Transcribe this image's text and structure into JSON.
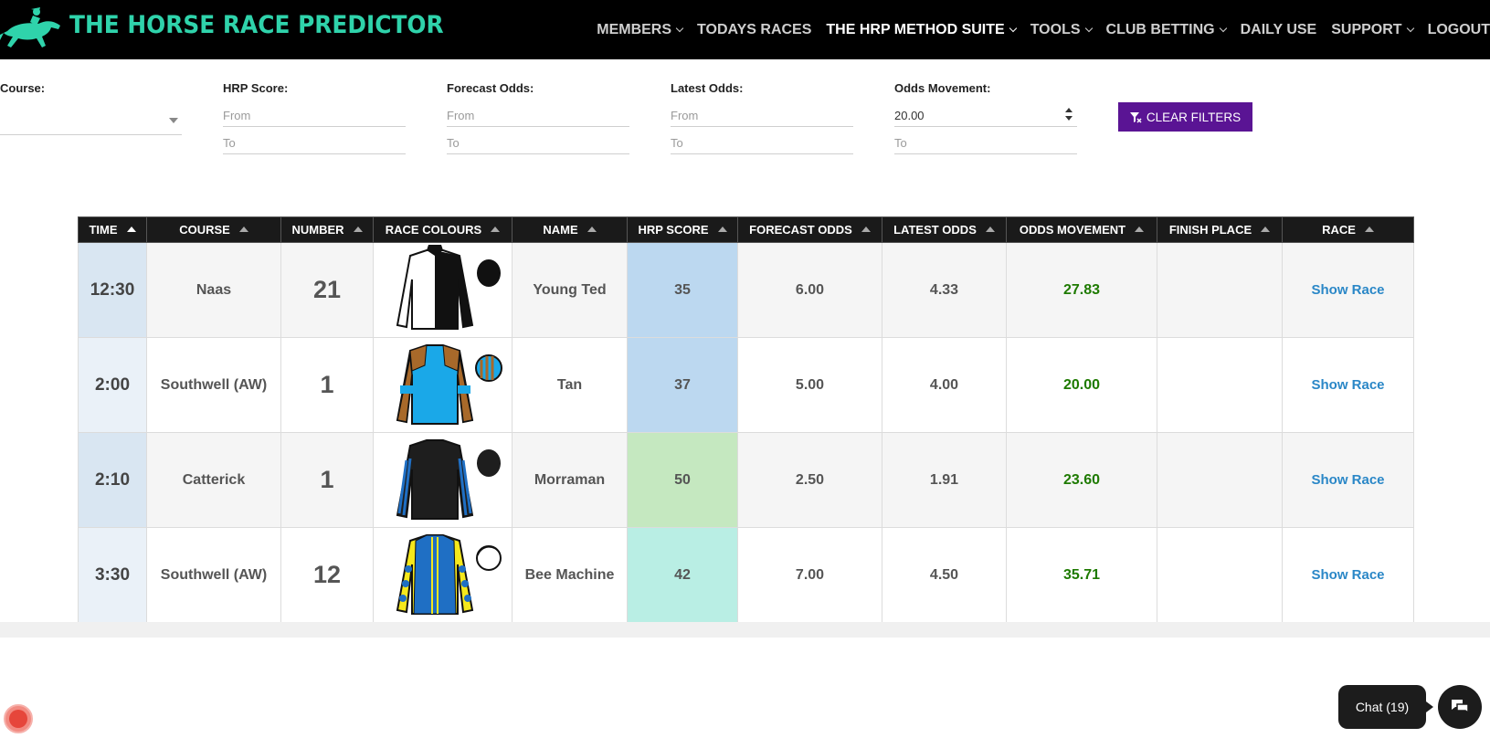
{
  "brand": {
    "name": "THE HORSE RACE PREDICTOR",
    "color": "#2fd3ab",
    "logo_icon": "horse-jockey-icon"
  },
  "nav": {
    "items": [
      {
        "label": "MEMBERS",
        "dropdown": true,
        "active": false
      },
      {
        "label": "TODAYS RACES",
        "dropdown": false,
        "active": false
      },
      {
        "label": "THE HRP METHOD SUITE",
        "dropdown": true,
        "active": true
      },
      {
        "label": "TOOLS",
        "dropdown": true,
        "active": false
      },
      {
        "label": "CLUB BETTING",
        "dropdown": true,
        "active": false
      },
      {
        "label": "DAILY USE",
        "dropdown": false,
        "active": false
      },
      {
        "label": "SUPPORT",
        "dropdown": true,
        "active": false
      },
      {
        "label": "LOGOUT",
        "dropdown": false,
        "active": false
      }
    ]
  },
  "filters": {
    "course": {
      "label": "Course:",
      "value": ""
    },
    "hrp_score": {
      "label": "HRP Score:",
      "from_placeholder": "From",
      "to_placeholder": "To"
    },
    "forecast_odds": {
      "label": "Forecast Odds:",
      "from_placeholder": "From",
      "to_placeholder": "To"
    },
    "latest_odds": {
      "label": "Latest Odds:",
      "from_placeholder": "From",
      "to_placeholder": "To"
    },
    "odds_movement": {
      "label": "Odds Movement:",
      "from_value": "20.00",
      "to_placeholder": "To"
    },
    "clear_label": "CLEAR FILTERS",
    "clear_color": "#5a1494"
  },
  "table": {
    "headers": [
      "TIME",
      "COURSE",
      "NUMBER",
      "RACE COLOURS",
      "NAME",
      "HRP SCORE",
      "FORECAST ODDS",
      "LATEST ODDS",
      "ODDS MOVEMENT",
      "FINISH PLACE",
      "RACE"
    ],
    "rows": [
      {
        "time": "12:30",
        "course": "Naas",
        "number": "21",
        "silk": "white-black-halves",
        "name": "Young Ted",
        "hrp_score": "35",
        "score_color": "#bcd8f0",
        "forecast_odds": "6.00",
        "latest_odds": "4.33",
        "odds_movement": "27.83",
        "finish_place": "",
        "race_link": "Show Race"
      },
      {
        "time": "2:00",
        "course": "Southwell (AW)",
        "number": "1",
        "silk": "light-blue-brown-epaulets",
        "name": "Tan",
        "hrp_score": "37",
        "score_color": "#bcd8f0",
        "forecast_odds": "5.00",
        "latest_odds": "4.00",
        "odds_movement": "20.00",
        "finish_place": "",
        "race_link": "Show Race"
      },
      {
        "time": "2:10",
        "course": "Catterick",
        "number": "1",
        "silk": "black-blue-striped-sleeves",
        "name": "Morraman",
        "hrp_score": "50",
        "score_color": "#c5e8c0",
        "forecast_odds": "2.50",
        "latest_odds": "1.91",
        "odds_movement": "23.60",
        "finish_place": "",
        "race_link": "Show Race"
      },
      {
        "time": "3:30",
        "course": "Southwell (AW)",
        "number": "12",
        "silk": "yellow-blue-spots",
        "name": "Bee Machine",
        "hrp_score": "42",
        "score_color": "#b9eee4",
        "forecast_odds": "7.00",
        "latest_odds": "4.50",
        "odds_movement": "35.71",
        "finish_place": "",
        "race_link": "Show Race"
      }
    ],
    "movement_color": "#1e7a00",
    "link_color": "#2a87c7"
  },
  "chat": {
    "label": "Chat (19)"
  }
}
